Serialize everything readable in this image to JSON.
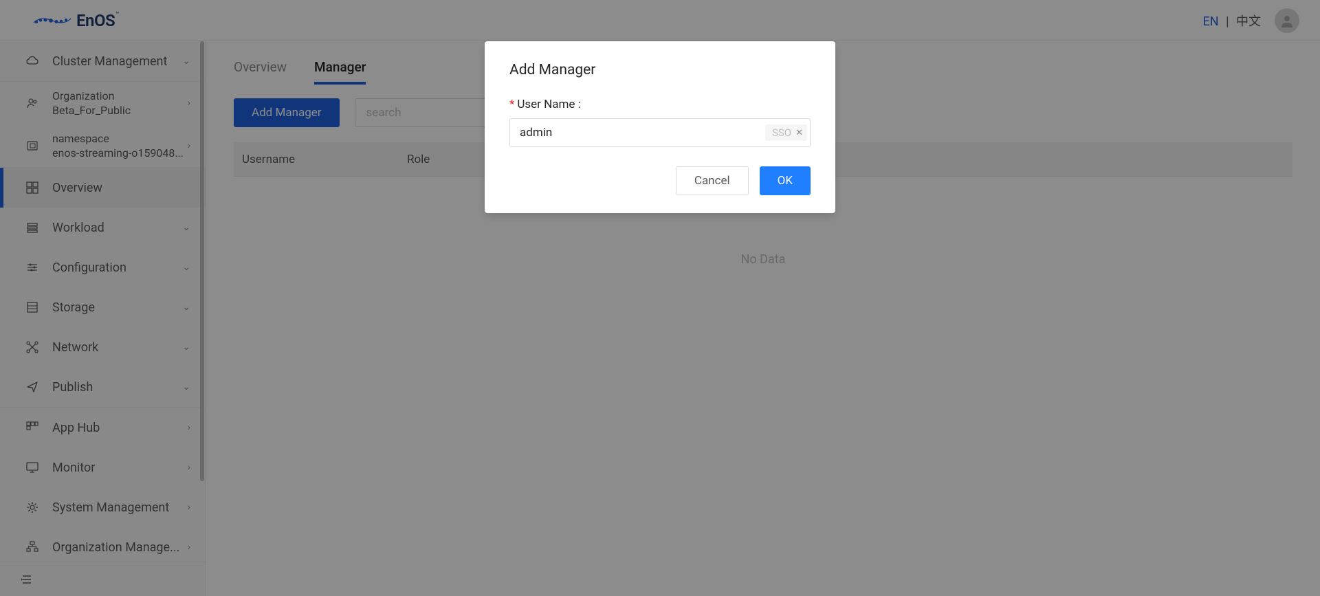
{
  "header": {
    "brand": "EnOS",
    "lang": {
      "en": "EN",
      "divider": "|",
      "zh": "中文"
    }
  },
  "sidebar": {
    "cluster": {
      "label": "Cluster Management"
    },
    "org": {
      "label": "Organization",
      "value": "Beta_For_Public"
    },
    "namespace": {
      "label": "namespace",
      "value": "enos-streaming-o159048..."
    },
    "items": [
      {
        "label": "Overview",
        "icon": "overview"
      },
      {
        "label": "Workload",
        "icon": "workload",
        "chev": "down"
      },
      {
        "label": "Configuration",
        "icon": "config",
        "chev": "down"
      },
      {
        "label": "Storage",
        "icon": "storage",
        "chev": "down"
      },
      {
        "label": "Network",
        "icon": "network",
        "chev": "down"
      },
      {
        "label": "Publish",
        "icon": "publish",
        "chev": "down"
      },
      {
        "label": "App Hub",
        "icon": "apphub",
        "chev": "right"
      },
      {
        "label": "Monitor",
        "icon": "monitor",
        "chev": "right"
      },
      {
        "label": "System Management",
        "icon": "system",
        "chev": "right"
      },
      {
        "label": "Organization Manage...",
        "icon": "orgm",
        "chev": "right"
      }
    ]
  },
  "tabs": {
    "overview": "Overview",
    "manager": "Manager"
  },
  "actions": {
    "add_manager": "Add Manager",
    "search_placeholder": "search"
  },
  "table": {
    "col_username": "Username",
    "col_role": "Role",
    "no_data": "No Data"
  },
  "modal": {
    "title": "Add Manager",
    "field_label": "User Name :",
    "input_value": "admin",
    "tag_text": "SSO",
    "cancel": "Cancel",
    "ok": "OK"
  }
}
